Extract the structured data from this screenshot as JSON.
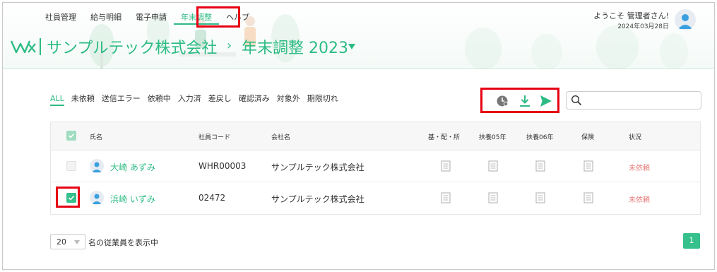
{
  "nav": {
    "items": [
      {
        "label": "社員管理"
      },
      {
        "label": "給与明細"
      },
      {
        "label": "電子申請"
      },
      {
        "label": "年末調整"
      },
      {
        "label": "ヘルプ"
      }
    ],
    "active_index": 3
  },
  "user": {
    "welcome": "ようこそ 管理者さん!",
    "date": "2024年03月28日"
  },
  "header": {
    "company": "サンプルテック株式会社",
    "separator": "›",
    "page_title": "年末調整 2023"
  },
  "filters": [
    {
      "label": "ALL",
      "active": true
    },
    {
      "label": "未依頼"
    },
    {
      "label": "送信エラー"
    },
    {
      "label": "依頼中"
    },
    {
      "label": "入力済"
    },
    {
      "label": "差戻し"
    },
    {
      "label": "確認済み"
    },
    {
      "label": "対象外"
    },
    {
      "label": "期限切れ"
    }
  ],
  "toolbar": {
    "icons": [
      "clock-icon",
      "download-icon",
      "send-icon"
    ]
  },
  "search": {
    "value": "",
    "placeholder": ""
  },
  "table": {
    "headers": {
      "name": "氏名",
      "code": "社員コード",
      "company": "会社名",
      "doc1": "基・配・所",
      "doc2": "扶養05年",
      "doc3": "扶養06年",
      "doc4": "保険",
      "status": "状況"
    },
    "rows": [
      {
        "name": "大崎 あずみ",
        "code": "WHR00003",
        "company": "サンプルテック株式会社",
        "status": "未依頼",
        "checked": false
      },
      {
        "name": "浜崎 いずみ",
        "code": "02472",
        "company": "サンプルテック株式会社",
        "status": "未依頼",
        "checked": true
      }
    ]
  },
  "footer": {
    "per_page": "20",
    "per_page_text": "名の従業員を表示中",
    "current_page": "1"
  },
  "colors": {
    "accent": "#2dbb84",
    "highlight": "#e60012",
    "status": "#e87d7d"
  }
}
